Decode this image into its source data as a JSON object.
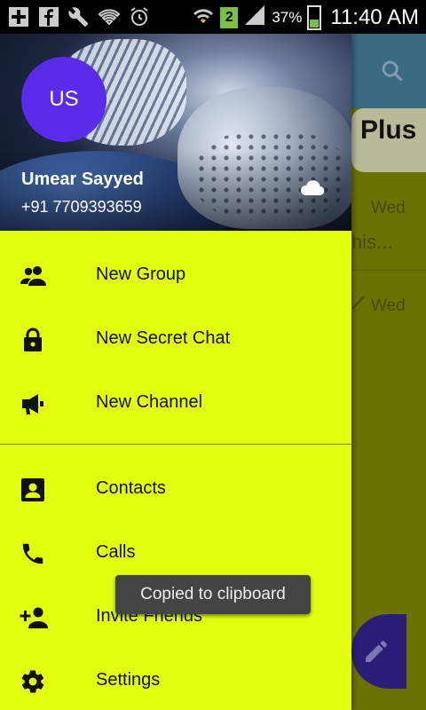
{
  "status_bar": {
    "left_icons": [
      "add-icon",
      "facebook-icon",
      "wrench-icon",
      "wifi-icon",
      "alarm-icon"
    ],
    "right_icons": [
      "wifi-data-icon"
    ],
    "notification_count": "2",
    "battery_percent": "37%",
    "time": "11:40 AM"
  },
  "drawer": {
    "avatar_initials": "US",
    "user_name": "Umear Sayyed",
    "user_phone": "+91 7709393659",
    "items": [
      {
        "icon": "group-icon",
        "label": "New Group"
      },
      {
        "icon": "lock-icon",
        "label": "New Secret Chat"
      },
      {
        "icon": "megaphone-icon",
        "label": "New Channel"
      },
      {
        "icon": "contacts-icon",
        "label": "Contacts"
      },
      {
        "icon": "phone-icon",
        "label": "Calls"
      },
      {
        "icon": "add-person-icon",
        "label": "Invite Friends"
      },
      {
        "icon": "settings-icon",
        "label": "Settings"
      }
    ]
  },
  "background_app": {
    "title_fragment": "Plus",
    "rows": [
      {
        "date": "Wed",
        "snippet": "his..."
      },
      {
        "date": "Wed"
      }
    ]
  },
  "toast": "Copied to clipboard",
  "colors": {
    "drawer_bg": "#e2ff0f",
    "avatar_bg": "#5b2bea",
    "toolbar_bg": "#3a6a84",
    "fab_bg": "#2b1e77"
  }
}
